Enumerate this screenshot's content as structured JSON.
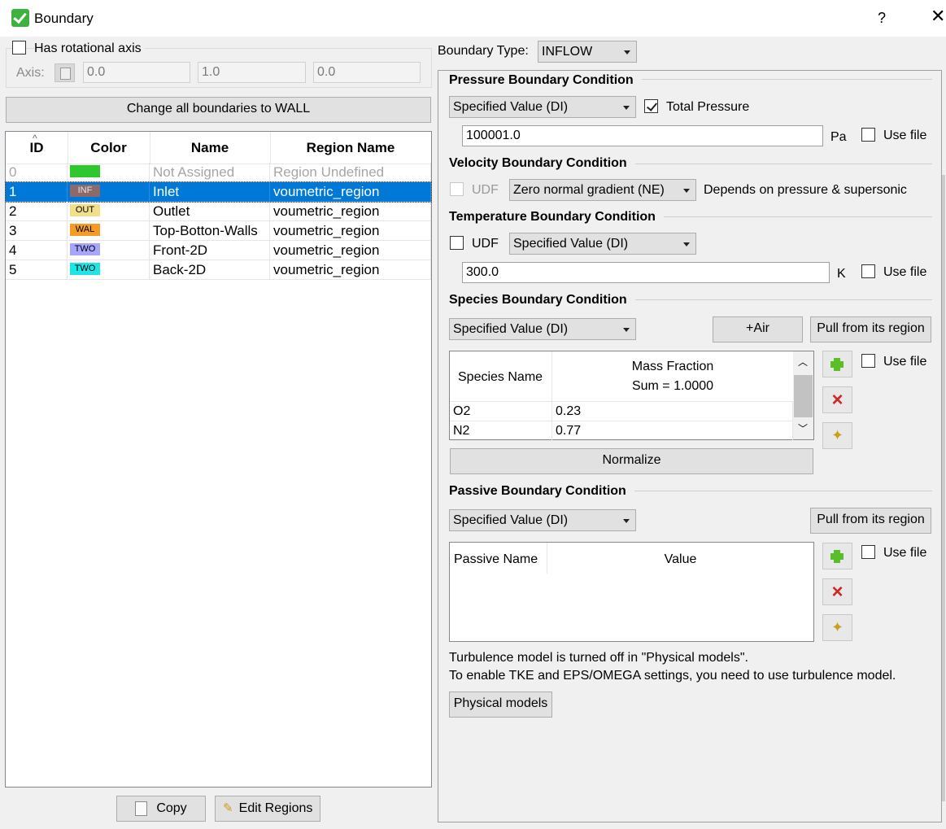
{
  "window": {
    "title": "Boundary",
    "help": "?",
    "close": "✕"
  },
  "left": {
    "rot_axis_label": "Has rotational axis",
    "axis_label": "Axis:",
    "axis_values": [
      "0.0",
      "1.0",
      "0.0"
    ],
    "change_all_label": "Change all boundaries to WALL",
    "table": {
      "headers": {
        "id": "ID",
        "color": "Color",
        "name": "Name",
        "region": "Region Name"
      },
      "rows": [
        {
          "id": "0",
          "tag": "",
          "color": "#2ec82e",
          "name": "Not Assigned",
          "region": "Region Undefined"
        },
        {
          "id": "1",
          "tag": "INF",
          "color": "#8c6a6a",
          "name": "Inlet",
          "region": "voumetric_region"
        },
        {
          "id": "2",
          "tag": "OUT",
          "color": "#f2df8a",
          "name": "Outlet",
          "region": "voumetric_region"
        },
        {
          "id": "3",
          "tag": "WAL",
          "color": "#f59a23",
          "name": "Top-Botton-Walls",
          "region": "voumetric_region"
        },
        {
          "id": "4",
          "tag": "TWO",
          "color": "#a6a6ff",
          "name": "Front-2D",
          "region": "voumetric_region"
        },
        {
          "id": "5",
          "tag": "TWO",
          "color": "#1ee6e6",
          "name": "Back-2D",
          "region": "voumetric_region"
        }
      ]
    },
    "copy_label": "Copy",
    "edit_regions_label": "Edit Regions"
  },
  "right": {
    "boundary_type_label": "Boundary Type:",
    "boundary_type_value": "INFLOW",
    "pressure": {
      "title": "Pressure Boundary Condition",
      "method": "Specified Value (DI)",
      "total_pressure_label": "Total Pressure",
      "value": "100001.0",
      "unit": "Pa",
      "use_file": "Use file"
    },
    "velocity": {
      "title": "Velocity Boundary Condition",
      "udf": "UDF",
      "method": "Zero normal gradient (NE)",
      "note": "Depends on pressure & supersonic"
    },
    "temperature": {
      "title": "Temperature Boundary Condition",
      "udf": "UDF",
      "method": "Specified Value (DI)",
      "value": "300.0",
      "unit": "K",
      "use_file": "Use file"
    },
    "species": {
      "title": "Species Boundary Condition",
      "method": "Specified Value (DI)",
      "air_button": "+Air",
      "pull_button": "Pull from its region",
      "col_name": "Species Name",
      "col_fraction": "Mass Fraction",
      "col_sum": "Sum = 1.0000",
      "rows": [
        {
          "name": "O2",
          "value": "0.23"
        },
        {
          "name": "N2",
          "value": "0.77"
        }
      ],
      "use_file": "Use file",
      "normalize": "Normalize"
    },
    "passive": {
      "title": "Passive Boundary Condition",
      "method": "Specified Value (DI)",
      "pull_button": "Pull from its region",
      "col_name": "Passive Name",
      "col_value": "Value",
      "use_file": "Use file"
    },
    "turbulence_note_1": "Turbulence model is turned off in \"Physical models\".",
    "turbulence_note_2": "To enable TKE and EPS/OMEGA settings, you need to use turbulence model.",
    "physical_models_button": "Physical models"
  }
}
